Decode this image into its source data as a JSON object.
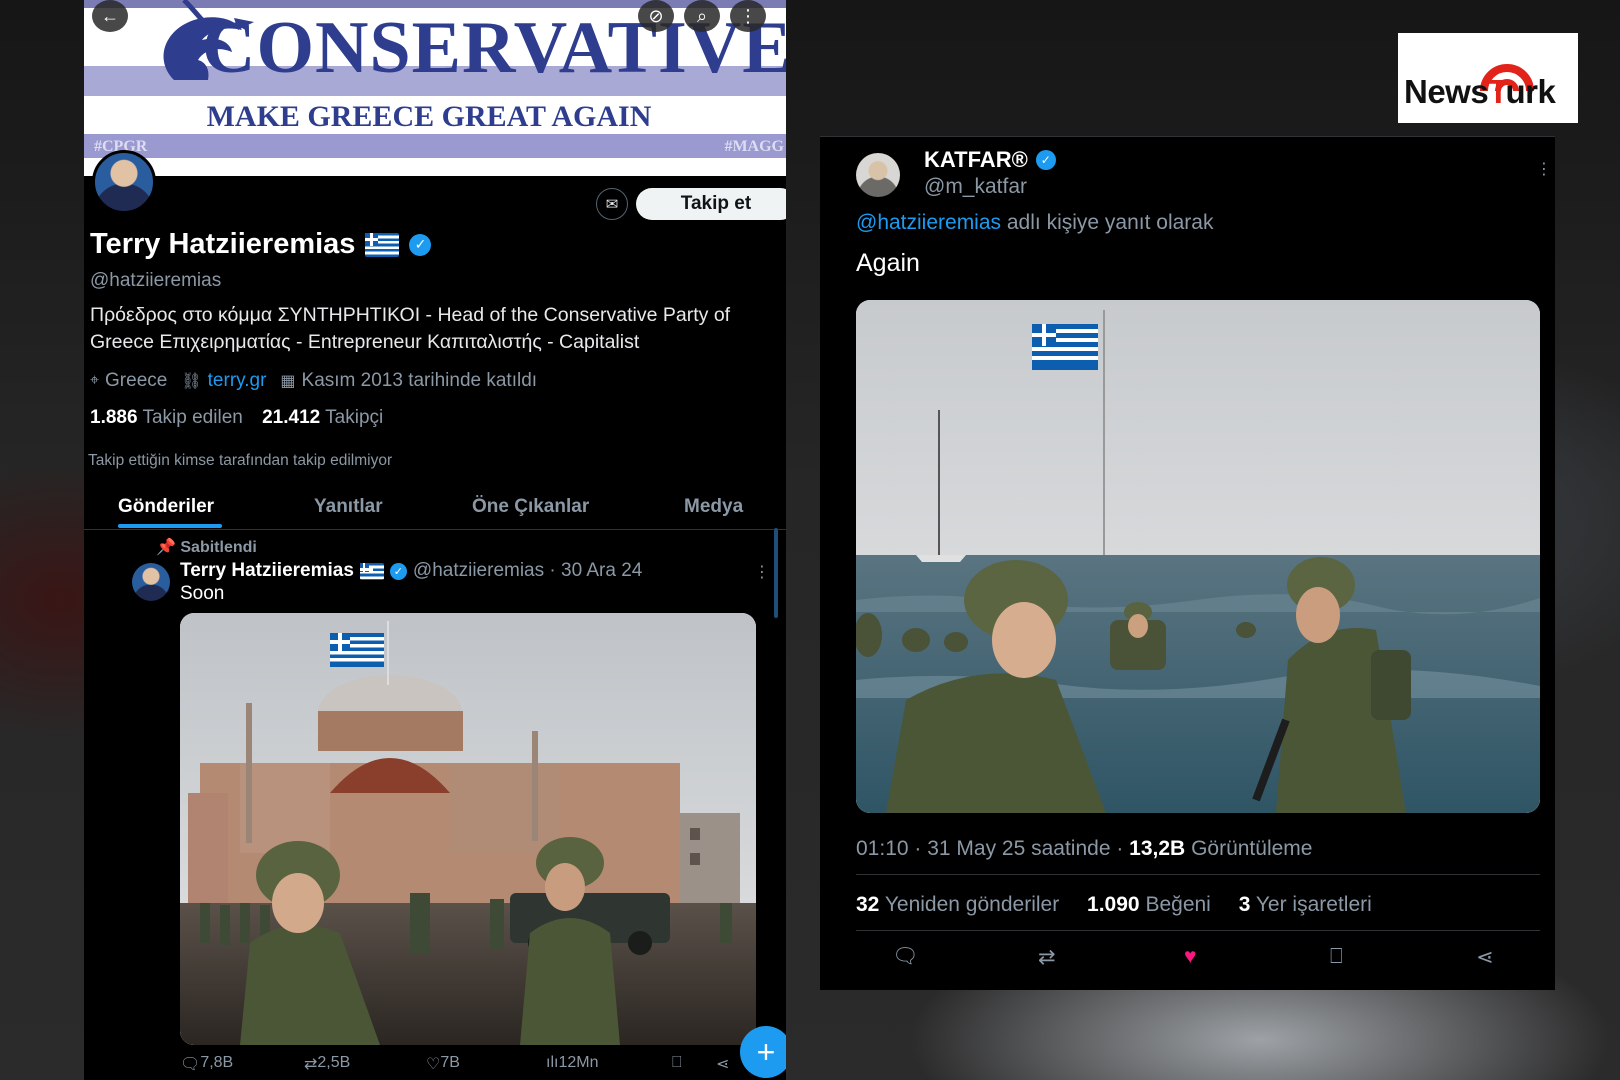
{
  "brand": {
    "logo_text_a": "News",
    "logo_text_t": "T",
    "logo_text_b": "urk"
  },
  "left": {
    "banner": {
      "title": "CONSERVATIVES",
      "subtitle": "MAKE GREECE GREAT AGAIN",
      "tag_left": "#CPGR",
      "tag_right": "#MAGG"
    },
    "profile": {
      "follow_label": "Takip et",
      "name": "Terry Hatziieremias",
      "handle": "@hatziieremias",
      "bio": "Πρόεδρος στο κόμμα ΣΥΝΤΗΡΗΤΙΚΟΙ - Head of the Conservative Party of Greece Επιχειρηματίας - Entrepreneur  Καπιταλιστής - Capitalist",
      "location": "Greece",
      "website": "terry.gr",
      "joined": "Kasım 2013 tarihinde katıldı",
      "following_count": "1.886",
      "following_label": "Takip edilen",
      "followers_count": "21.412",
      "followers_label": "Takipçi",
      "not_followed_note": "Takip ettiğin kimse tarafından takip edilmiyor"
    },
    "tabs": [
      {
        "label": "Gönderiler",
        "active": true
      },
      {
        "label": "Yanıtlar",
        "active": false
      },
      {
        "label": "Öne Çıkanlar",
        "active": false
      },
      {
        "label": "Medya",
        "active": false
      }
    ],
    "pinned_post": {
      "pinned_label": "Sabitlendi",
      "author": "Terry Hatziieremias",
      "handle_date": "@hatziieremias · 30 Ara 24",
      "text": "Soon",
      "replies": "7,8B",
      "reposts": "2,5B",
      "likes": "7B",
      "views": "12Mn"
    }
  },
  "right": {
    "author": "KATFAR®",
    "handle": "@m_katfar",
    "reply_to_handle": "@hatziieremias",
    "reply_to_suffix": "adlı kişiye yanıt olarak",
    "text": "Again",
    "timestamp": "01:10 · 31 May 25 saatinde · ",
    "views_count": "13,2B",
    "views_label": "Görüntüleme",
    "reposts_count": "32",
    "reposts_label": "Yeniden gönderiler",
    "likes_count": "1.090",
    "likes_label": "Beğeni",
    "bookmarks_count": "3",
    "bookmarks_label": "Yer işaretleri"
  },
  "colors": {
    "accent": "#1d9bf0",
    "like": "#f91880",
    "background": "#000000"
  }
}
